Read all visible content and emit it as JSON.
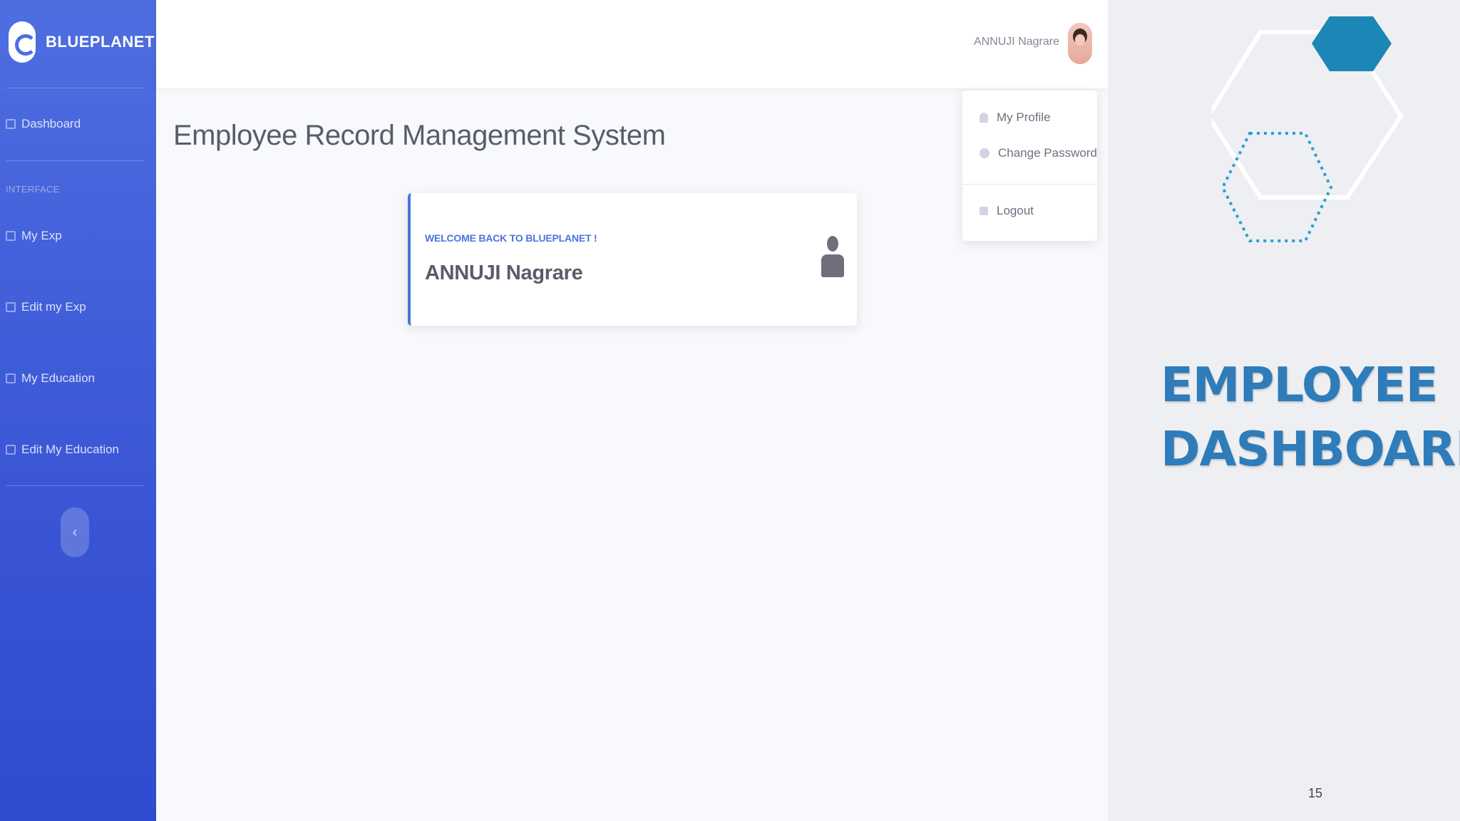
{
  "sidebar": {
    "brand": "BLUEPLANET",
    "items": [
      {
        "label": "Dashboard"
      },
      {
        "label": "My Exp"
      },
      {
        "label": "Edit my Exp"
      },
      {
        "label": "My Education"
      },
      {
        "label": "Edit My Education"
      }
    ],
    "section_label": "INTERFACE",
    "toggle_glyph": "‹"
  },
  "topbar": {
    "user_name": "ANNUJI Nagrare"
  },
  "dropdown": {
    "items": [
      {
        "label": "My Profile",
        "icon": "user-icon"
      },
      {
        "label": "Change Password",
        "icon": "gear-icon"
      },
      {
        "label": "Logout",
        "icon": "logout-icon"
      }
    ]
  },
  "main": {
    "title": "Employee Record Management System",
    "welcome_card": {
      "label": "WELCOME BACK TO BLUEPLANET !",
      "name": "ANNUJI Nagrare",
      "icon": "user-icon"
    }
  },
  "slide": {
    "title_line1": "EMPLOYEE",
    "title_line2": "DASHBOARD",
    "page_number": "15",
    "accent_color": "#1c86b7",
    "title_color": "#2e7cb9"
  }
}
